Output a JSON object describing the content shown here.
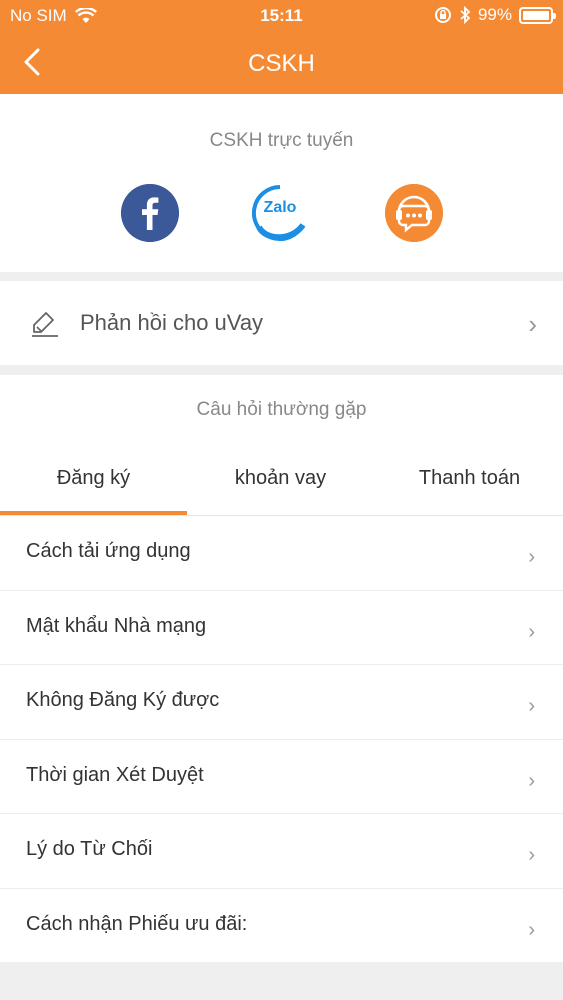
{
  "status_bar": {
    "carrier": "No SIM",
    "time": "15:11",
    "battery_percent": "99%",
    "battery_level": 0.99
  },
  "nav": {
    "title": "CSKH",
    "back_icon": "chevron-left-icon"
  },
  "online_support": {
    "title": "CSKH trực tuyến",
    "channels": [
      {
        "name": "facebook-icon",
        "color": "#3b5998"
      },
      {
        "name": "zalo-icon",
        "label": "Zalo",
        "color": "#1b8fe4"
      },
      {
        "name": "support-chat-icon",
        "color": "#f58a34"
      }
    ]
  },
  "feedback": {
    "label": "Phản hồi cho uVay",
    "icon": "edit-icon"
  },
  "faq": {
    "title": "Câu hỏi thường gặp",
    "tabs": [
      {
        "label": "Đăng ký",
        "active": true
      },
      {
        "label": "khoản vay",
        "active": false
      },
      {
        "label": "Thanh toán",
        "active": false
      }
    ],
    "items": [
      {
        "label": "Cách tải ứng dụng"
      },
      {
        "label": "Mật khẩu Nhà mạng"
      },
      {
        "label": "Không Đăng Ký được"
      },
      {
        "label": "Thời gian Xét Duyệt"
      },
      {
        "label": "Lý do Từ Chối"
      },
      {
        "label": "Cách nhận Phiếu ưu đãi:"
      }
    ]
  },
  "colors": {
    "accent": "#f58a34",
    "background": "#efefef",
    "card": "#ffffff"
  }
}
